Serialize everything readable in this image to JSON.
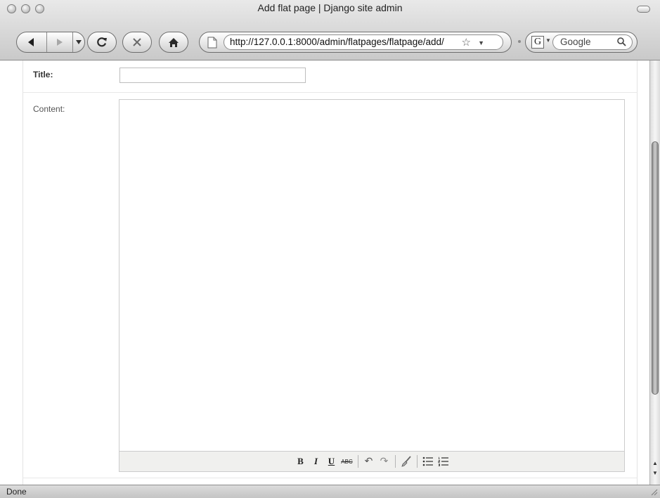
{
  "window": {
    "title": "Add flat page | Django site admin"
  },
  "toolbar": {
    "url": "http://127.0.0.1:8000/admin/flatpages/flatpage/add/",
    "search_placeholder": "Google",
    "back_icon": "triangle-left",
    "forward_icon": "triangle-right",
    "reload_icon": "reload",
    "stop_icon": "x",
    "home_icon": "house",
    "bookmark_icon": "star-outline"
  },
  "form": {
    "title_label": "Title:",
    "title_value": "",
    "content_label": "Content:"
  },
  "editor_toolbar": {
    "bold": "B",
    "italic": "I",
    "underline": "U",
    "strikethrough": "ABC",
    "undo": "↶",
    "redo": "↷",
    "cleanup": "🧹",
    "bullet_list": "☰",
    "numbered_list": "☰"
  },
  "status": {
    "text": "Done"
  }
}
